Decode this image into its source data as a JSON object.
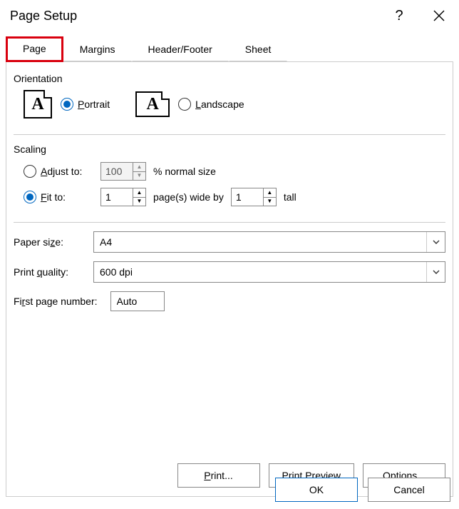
{
  "title": "Page Setup",
  "tabs": {
    "page": "Page",
    "margins": "Margins",
    "headerfooter": "Header/Footer",
    "sheet": "Sheet"
  },
  "orientation": {
    "heading": "Orientation",
    "portrait_prefix": "P",
    "portrait_rest": "ortrait",
    "landscape_prefix": "L",
    "landscape_rest": "andscape"
  },
  "scaling": {
    "heading": "Scaling",
    "adjust_prefix": "A",
    "adjust_rest": "djust to:",
    "adjust_value": "100",
    "adjust_suffix": "% normal size",
    "fit_prefix": "F",
    "fit_rest": "it to:",
    "fit_wide_value": "1",
    "fit_mid": " page(s) wide by ",
    "fit_tall_value": "1",
    "fit_tall_suffix": " tall"
  },
  "paper": {
    "size_label_prefix": "Paper si",
    "size_label_hot": "z",
    "size_label_rest": "e:",
    "size_value": "A4",
    "quality_label_prefix": "Print ",
    "quality_label_hot": "q",
    "quality_label_rest": "uality:",
    "quality_value": "600 dpi"
  },
  "firstpage": {
    "label_prefix": "Fi",
    "label_hot": "r",
    "label_rest": "st page number:",
    "value": "Auto"
  },
  "buttons": {
    "print_hot": "P",
    "print_rest": "rint...",
    "preview": "Print Previe",
    "preview_hot": "w",
    "options_hot": "O",
    "options_rest": "ptions...",
    "ok": "OK",
    "cancel": "Cancel"
  }
}
